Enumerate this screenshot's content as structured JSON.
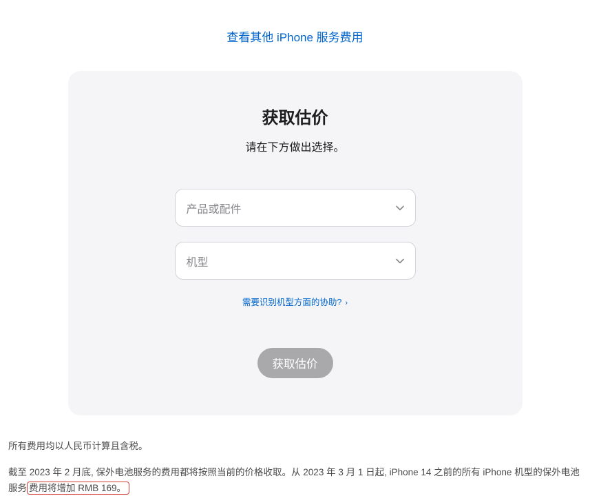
{
  "top_link": "查看其他 iPhone 服务费用",
  "card": {
    "title": "获取估价",
    "subtitle": "请在下方做出选择。",
    "select_product_placeholder": "产品或配件",
    "select_model_placeholder": "机型",
    "help_link": "需要识别机型方面的协助?",
    "submit_label": "获取估价"
  },
  "note_tax": "所有费用均以人民币计算且含税。",
  "note_policy_pre": "截至 2023 年 2 月底, 保外电池服务的费用都将按照当前的价格收取。从 2023 年 3 月 1 日起, iPhone 14 之前的所有 iPhone 机型的保外电池服务",
  "note_policy_highlight": "费用将增加 RMB 169。"
}
